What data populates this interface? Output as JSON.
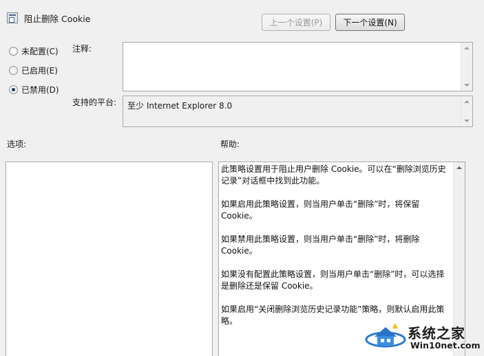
{
  "dialog": {
    "title": "阻止删除 Cookie",
    "prev_label": "上一个设置(P)",
    "next_label": "下一个设置(N)"
  },
  "radios": [
    {
      "label": "未配置(C)",
      "checked": false
    },
    {
      "label": "已启用(E)",
      "checked": false
    },
    {
      "label": "已禁用(D)",
      "checked": true
    }
  ],
  "comment": {
    "label": "注释:",
    "value": ""
  },
  "platform": {
    "label": "支持的平台:",
    "value": "至少 Internet Explorer 8.0"
  },
  "options": {
    "label": "选项:"
  },
  "help": {
    "label": "帮助:",
    "paragraphs": [
      "此策略设置用于阻止用户删除 Cookie。可以在“删除浏览历史记录”对话框中找到此功能。",
      "如果启用此策略设置，则当用户单击“删除”时，将保留 Cookie。",
      "如果禁用此策略设置，则当用户单击“删除”时，将删除 Cookie。",
      "如果没有配置此策略设置，则当用户单击“删除”时，可以选择是删除还是保留 Cookie。",
      "如果启用“关闭删除浏览历史记录功能”策略，则默认启用此策略。"
    ]
  },
  "watermark": {
    "title": "系统之家",
    "url": "Win10net.com"
  }
}
